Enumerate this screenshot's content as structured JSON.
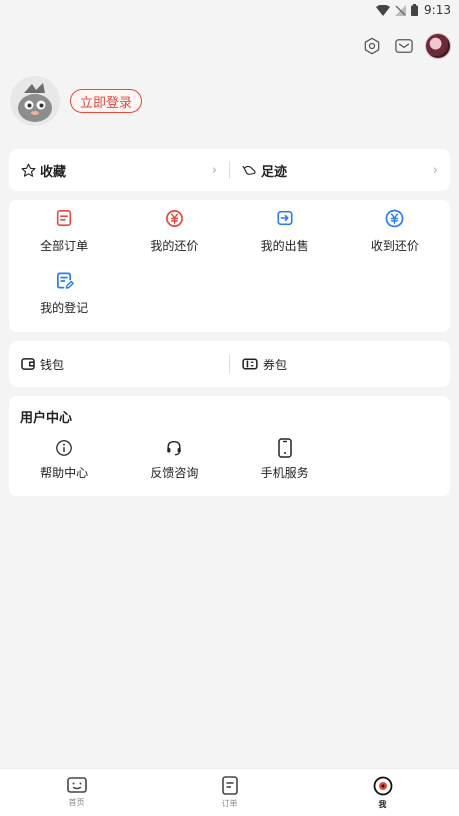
{
  "status_bar": {
    "time": "9:13"
  },
  "profile": {
    "login_label": "立即登录"
  },
  "quick_links": [
    {
      "label": "收藏",
      "icon": "star-icon"
    },
    {
      "label": "足迹",
      "icon": "footprint-icon"
    }
  ],
  "orders": [
    {
      "label": "全部订单",
      "icon": "order-list-icon",
      "color": "#e9483c"
    },
    {
      "label": "我的还价",
      "icon": "yen-circle-icon",
      "color": "#e9483c"
    },
    {
      "label": "我的出售",
      "icon": "sell-icon",
      "color": "#2b7cf0"
    },
    {
      "label": "收到还价",
      "icon": "yen-badge-icon",
      "color": "#2b7cf0"
    },
    {
      "label": "我的登记",
      "icon": "register-icon",
      "color": "#2b7cf0"
    }
  ],
  "wallet": [
    {
      "label": "钱包",
      "icon": "wallet-icon"
    },
    {
      "label": "券包",
      "icon": "coupon-icon"
    }
  ],
  "user_center": {
    "title": "用户中心",
    "items": [
      {
        "label": "帮助中心",
        "icon": "info-icon"
      },
      {
        "label": "反馈咨询",
        "icon": "headset-icon"
      },
      {
        "label": "手机服务",
        "icon": "phone-icon"
      }
    ]
  },
  "tabbar": [
    {
      "label": "首页",
      "icon": "home-face-icon"
    },
    {
      "label": "订单",
      "icon": "order-doc-icon"
    },
    {
      "label": "我",
      "icon": "me-icon"
    }
  ]
}
